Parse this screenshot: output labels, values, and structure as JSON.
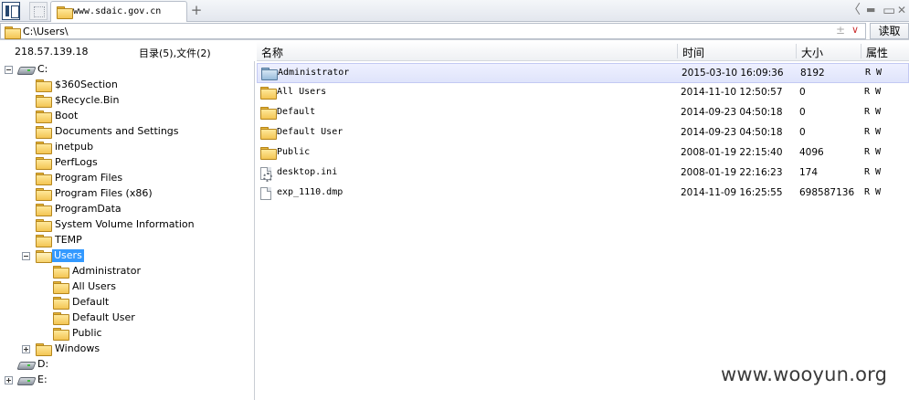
{
  "tabbar": {
    "tab_title": "www.sdaic.gov.cn",
    "add_tab": "+",
    "back": "〈",
    "minimize": "▬",
    "maximize": "▭",
    "close": "✕"
  },
  "address": {
    "path": "C:\\Users\\",
    "plusminus": "±",
    "dropdown": "∨",
    "read_button": "读取"
  },
  "info": {
    "ip": "218.57.139.18",
    "counts": "目录(5),文件(2)"
  },
  "tree": [
    {
      "label": "C:",
      "type": "drive",
      "expander": "minus"
    },
    {
      "label": "$360Section",
      "type": "folder"
    },
    {
      "label": "$Recycle.Bin",
      "type": "folder"
    },
    {
      "label": "Boot",
      "type": "folder"
    },
    {
      "label": "Documents and Settings",
      "type": "folder"
    },
    {
      "label": "inetpub",
      "type": "folder"
    },
    {
      "label": "PerfLogs",
      "type": "folder"
    },
    {
      "label": "Program Files",
      "type": "folder"
    },
    {
      "label": "Program Files (x86)",
      "type": "folder"
    },
    {
      "label": "ProgramData",
      "type": "folder"
    },
    {
      "label": "System Volume Information",
      "type": "folder"
    },
    {
      "label": "TEMP",
      "type": "folder"
    },
    {
      "label": "Users",
      "type": "folder",
      "expander": "minus",
      "selected": true
    },
    {
      "label": "Administrator",
      "type": "folder"
    },
    {
      "label": "All Users",
      "type": "folder"
    },
    {
      "label": "Default",
      "type": "folder"
    },
    {
      "label": "Default User",
      "type": "folder"
    },
    {
      "label": "Public",
      "type": "folder"
    },
    {
      "label": "Windows",
      "type": "folder",
      "expander": "plus"
    },
    {
      "label": "D:",
      "type": "drive"
    },
    {
      "label": "E:",
      "type": "drive",
      "expander": "plus"
    }
  ],
  "list": {
    "headers": {
      "name": "名称",
      "time": "时间",
      "size": "大小",
      "attr": "属性"
    },
    "rows": [
      {
        "name": "Administrator",
        "time": "2015-03-10 16:09:36",
        "size": "8192",
        "attr": "R W",
        "icon": "folder-blue",
        "selected": true
      },
      {
        "name": "All Users",
        "time": "2014-11-10 12:50:57",
        "size": "0",
        "attr": "R W",
        "icon": "folder"
      },
      {
        "name": "Default",
        "time": "2014-09-23 04:50:18",
        "size": "0",
        "attr": "R W",
        "icon": "folder"
      },
      {
        "name": "Default User",
        "time": "2014-09-23 04:50:18",
        "size": "0",
        "attr": "R W",
        "icon": "folder"
      },
      {
        "name": "Public",
        "time": "2008-01-19 22:15:40",
        "size": "4096",
        "attr": "R W",
        "icon": "folder"
      },
      {
        "name": "desktop.ini",
        "time": "2008-01-19 22:16:23",
        "size": "174",
        "attr": "R W",
        "icon": "settings-file"
      },
      {
        "name": "exp_1110.dmp",
        "time": "2014-11-09 16:25:55",
        "size": "698587136",
        "attr": "R W",
        "icon": "file"
      }
    ]
  },
  "watermark": "www.wooyun.org"
}
